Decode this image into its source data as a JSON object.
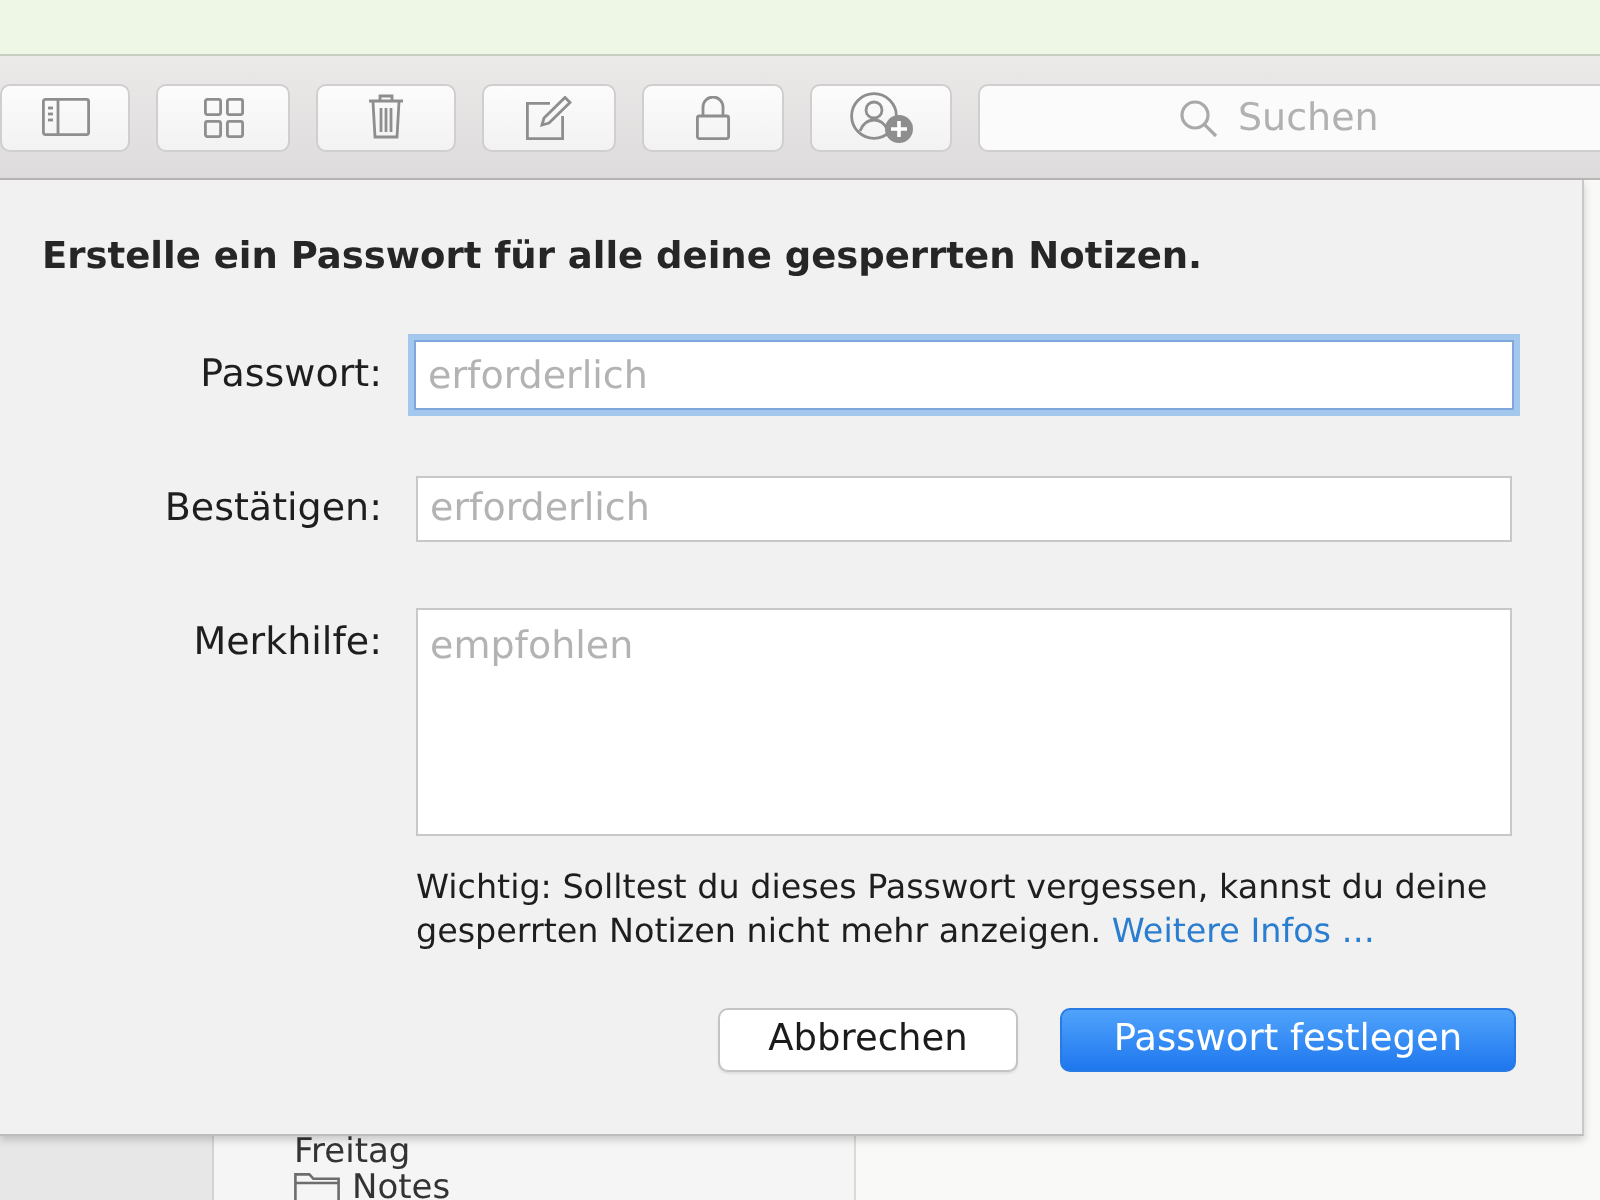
{
  "toolbar": {
    "buttons": [
      {
        "kind": "sidebar"
      },
      {
        "kind": "grid"
      },
      {
        "kind": "trash"
      },
      {
        "kind": "compose"
      },
      {
        "kind": "lock"
      },
      {
        "kind": "share"
      }
    ],
    "search": {
      "placeholder": "Suchen"
    }
  },
  "note_list": {
    "items": [
      {
        "kind": "heading",
        "text": "Freitag"
      },
      {
        "kind": "folder",
        "text": "Notes"
      }
    ]
  },
  "dialog": {
    "title": "Erstelle ein Passwort für alle deine gesperrten Notizen.",
    "fields": [
      {
        "label": "Passwort:",
        "placeholder": "erforderlich",
        "kind": "line",
        "focused": true
      },
      {
        "label": "Bestätigen:",
        "placeholder": "erforderlich",
        "kind": "line",
        "focused": false
      },
      {
        "label": "Merkhilfe:",
        "placeholder": "empfohlen",
        "kind": "area",
        "focused": false
      }
    ],
    "note": "Wichtig: Solltest du dieses Passwort vergessen, kannst du deine gesperrten Notizen nicht mehr anzeigen.",
    "link": "Weitere Infos …",
    "buttons": [
      {
        "label": "Abbrechen",
        "default": false
      },
      {
        "label": "Passwort festlegen",
        "default": true
      }
    ]
  }
}
